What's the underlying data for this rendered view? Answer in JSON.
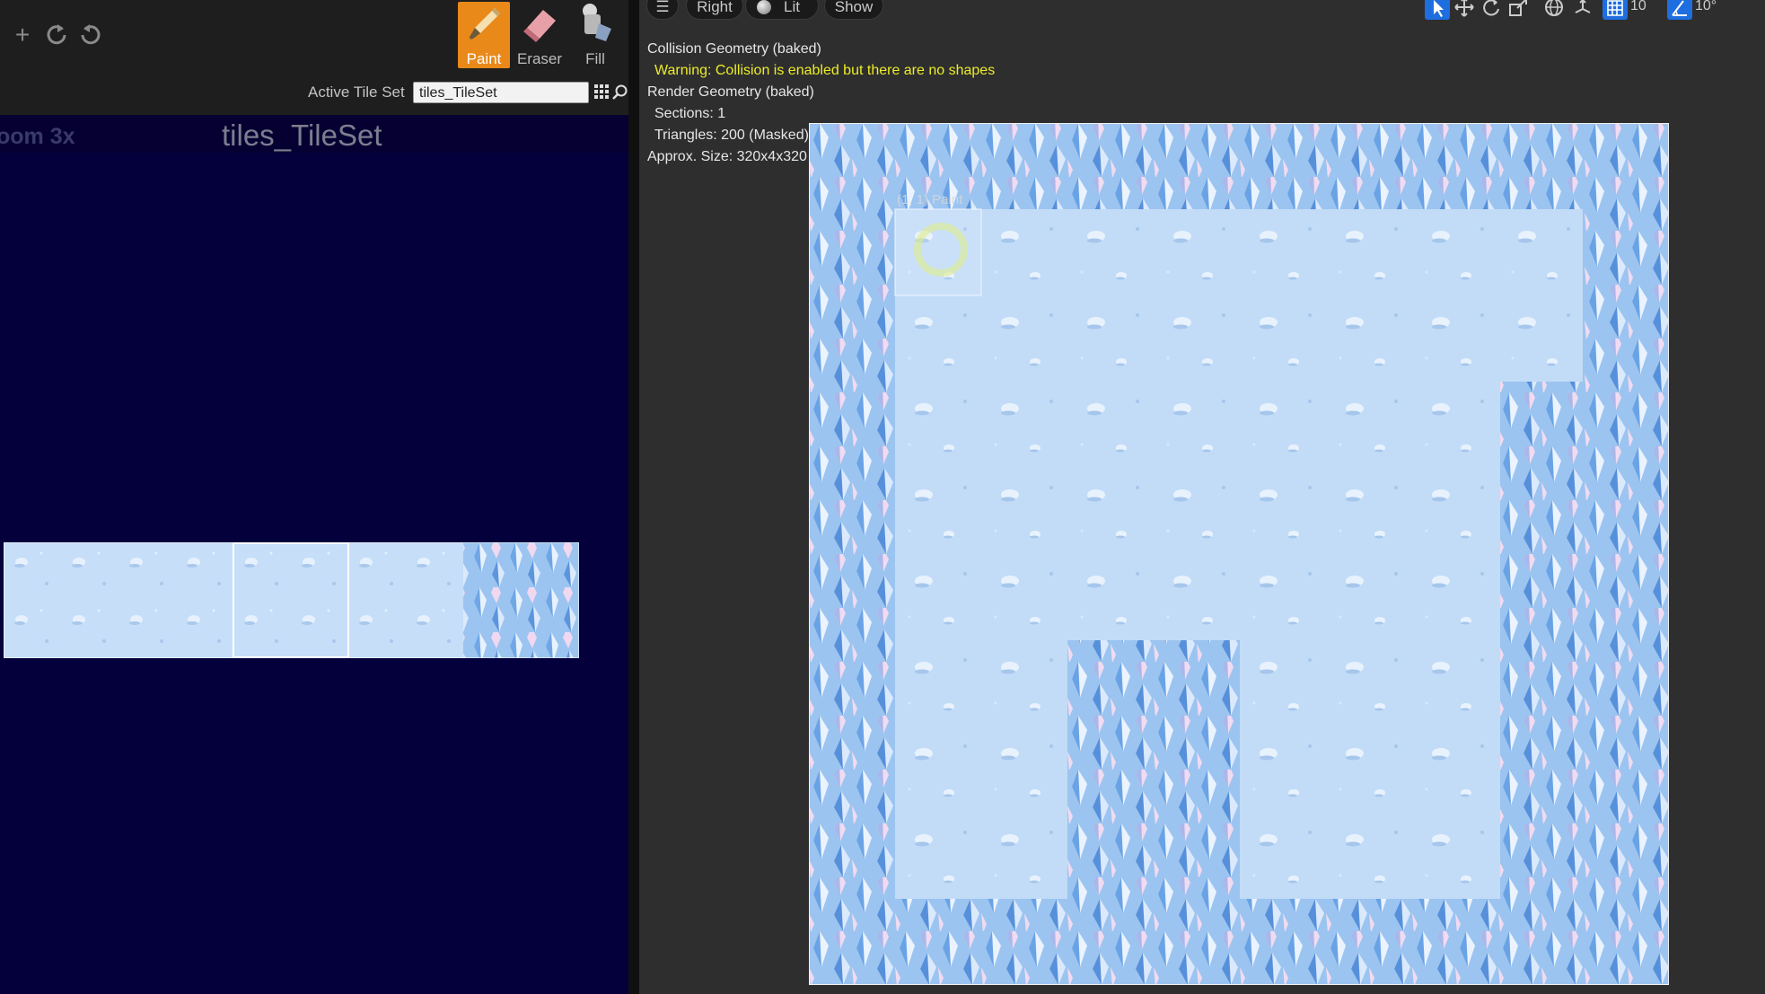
{
  "left_toolbar": {
    "tools": [
      {
        "label": "Paint",
        "icon": "paintbrush-icon",
        "active": true
      },
      {
        "label": "Eraser",
        "icon": "eraser-icon",
        "active": false
      },
      {
        "label": "Fill",
        "icon": "paint-bucket-icon",
        "active": false
      }
    ],
    "active_tileset_label": "Active Tile Set",
    "active_tileset_value": "tiles_TileSet"
  },
  "tileset_view": {
    "zoom": "oom 3x",
    "title": "tiles_TileSet"
  },
  "viewport_toolbar": {
    "view_mode": "Right",
    "lighting": "Lit",
    "show": "Show",
    "grid_snap": "10",
    "angle_snap": "10°"
  },
  "info": {
    "collision": "Collision Geometry (baked)",
    "warning": "Warning: Collision is enabled but there are no shapes",
    "render": "Render Geometry (baked)",
    "sections": "Sections: 1",
    "triangles": "Triangles: 200 (Masked)",
    "size": "Approx. Size: 320x4x320"
  },
  "cursor_label": "(1, 1) Paint",
  "colors": {
    "accent": "#e9891a",
    "warning": "#ecec2a",
    "tileset_bg": "#03003c",
    "floor": "#c2dcf7",
    "crystal": "#6fa6e6"
  }
}
